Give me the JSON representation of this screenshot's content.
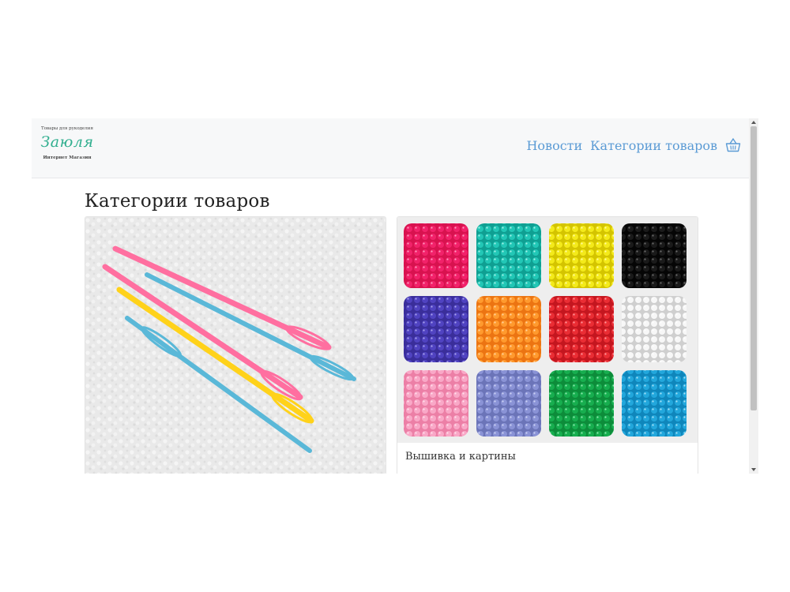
{
  "brand": {
    "tagline": "Товары для рукоделия",
    "name": "Заюля",
    "subtitle": "Интернет Магазин"
  },
  "nav": {
    "items": [
      {
        "label": "Новости"
      },
      {
        "label": "Категории товаров"
      }
    ],
    "cart_icon": "basket-icon",
    "link_color": "#5b9bd5"
  },
  "page": {
    "title": "Категории товаров"
  },
  "categories": [
    {
      "image": "plastic-needles-photo",
      "caption": ""
    },
    {
      "image": "colorful-beads-photo",
      "caption": "Вышивка и картины"
    }
  ],
  "colors": {
    "navbar_bg": "#f7f8f9",
    "brand": "#2fae8e"
  }
}
